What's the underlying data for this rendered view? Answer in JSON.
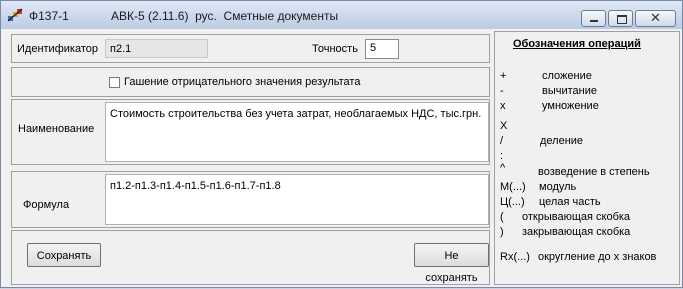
{
  "window": {
    "app_code": "Ф137-1",
    "title": "АВК-5 (2.11.6)  рус.  Сметные документы"
  },
  "form": {
    "identifier_label": "Идентификатор",
    "identifier_value": "п2.1",
    "precision_label": "Точность",
    "precision_value": "5",
    "negation_checkbox_label": "Гашение отрицательного значения результата",
    "negation_checked": false,
    "name_label": "Наименование",
    "name_value": "Стоимость строительства без учета затрат, необлагаемых НДС, тыс.грн.",
    "formula_label": "Формула",
    "formula_value": "п1.2-п1.3-п1.4-п1.5-п1.6-п1.7-п1.8",
    "save_label": "Сохранять",
    "dont_save_label": "Не сохранять"
  },
  "legend": {
    "title": "Обозначения операций",
    "ops": [
      {
        "symbol": "+",
        "description": "сложение"
      },
      {
        "symbol": "-",
        "description": "вычитание"
      },
      {
        "symbol": "x",
        "description": "умножение"
      },
      {
        "symbol": "X",
        "description": ""
      },
      {
        "symbol": "/",
        "description": "деление"
      },
      {
        "symbol": ":",
        "description": ""
      },
      {
        "symbol": "^",
        "description": "возведение в степень"
      },
      {
        "symbol": "М(...)",
        "description": "модуль"
      },
      {
        "symbol": "Ц(...)",
        "description": "целая часть"
      },
      {
        "symbol": "(",
        "description": "открывающая скобка"
      },
      {
        "symbol": ")",
        "description": "закрывающая скобка"
      },
      {
        "symbol": "Rx(...)",
        "description": "округление до x знаков"
      }
    ]
  }
}
